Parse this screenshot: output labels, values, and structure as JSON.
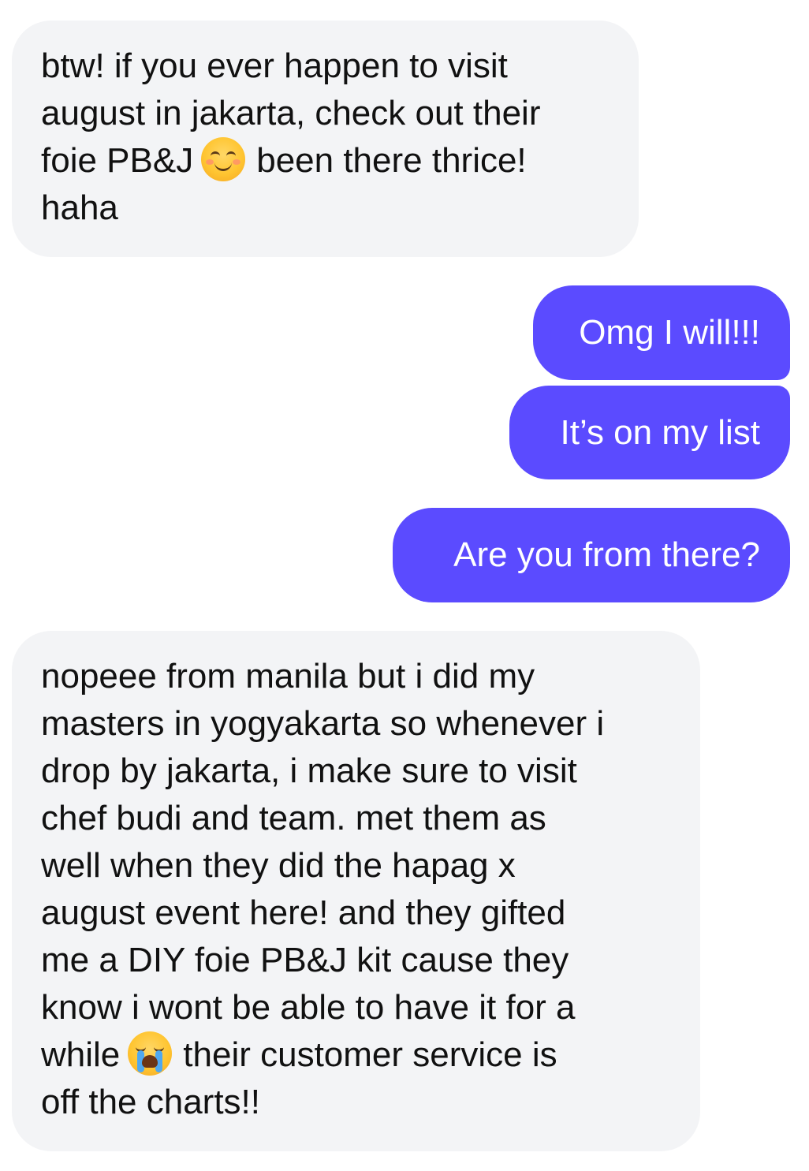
{
  "messages": [
    {
      "id": "m1",
      "direction": "incoming",
      "parts": [
        "btw! if you ever happen to visit\naugust in jakarta, check out their\nfoie PB&J",
        "smiling-face-icon",
        "been there thrice!\nhaha"
      ]
    },
    {
      "id": "m2",
      "direction": "outgoing",
      "text": "Omg I will!!!"
    },
    {
      "id": "m3",
      "direction": "outgoing",
      "text": "It’s on my list"
    },
    {
      "id": "m4",
      "direction": "outgoing",
      "text": "Are you from there?"
    },
    {
      "id": "m5",
      "direction": "incoming",
      "parts": [
        "nopeee from manila but i did my\nmasters in yogyakarta so whenever i\ndrop by jakarta, i make sure to visit\nchef budi and team. met them as\nwell when they did the hapag x\naugust event here! and they gifted\nme a DIY foie PB&J kit cause they\nknow i wont be able to have it for a\nwhile",
        "loudly-crying-face-icon",
        "their customer service is\noff the charts!!"
      ]
    }
  ],
  "colors": {
    "incoming_bubble": "#f3f4f6",
    "incoming_text": "#111111",
    "outgoing_bubble": "#5b4bff",
    "outgoing_text": "#ffffff"
  }
}
